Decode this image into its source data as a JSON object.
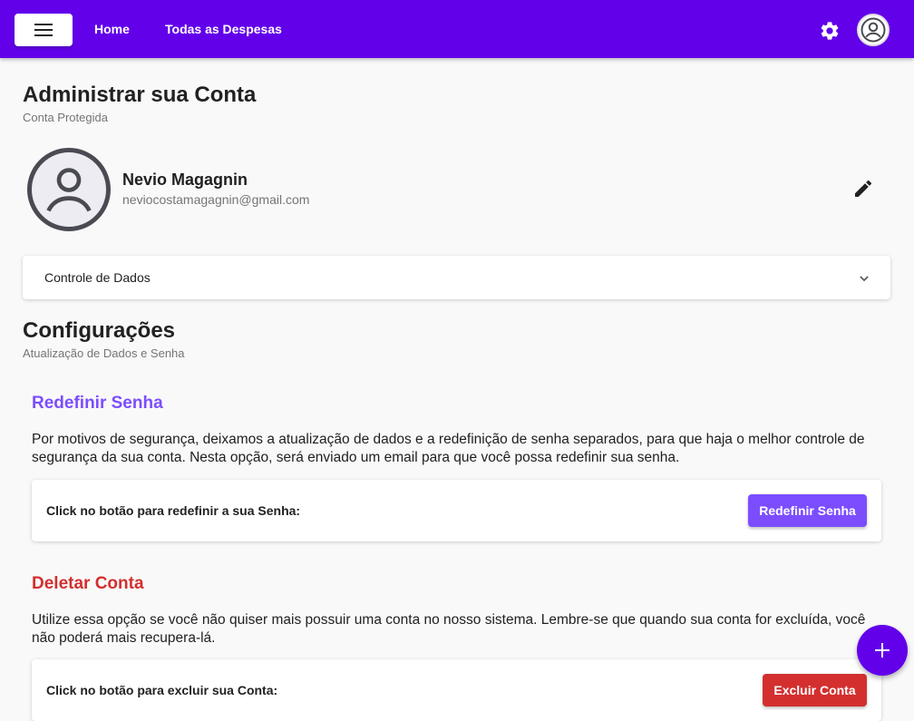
{
  "header": {
    "nav": [
      {
        "label": "Home"
      },
      {
        "label": "Todas as Despesas"
      }
    ],
    "icons": [
      "menu-icon",
      "gear-icon",
      "account-icon"
    ],
    "bar_color": "#6200ea"
  },
  "page": {
    "title": "Administrar sua Conta",
    "subtitle": "Conta Protegida"
  },
  "profile": {
    "name": "Nevio Magagnin",
    "email": "neviocostamagagnin@gmail.com"
  },
  "expansion": {
    "label": "Controle de Dados"
  },
  "settings": {
    "title": "Configurações",
    "subtitle": "Atualização de Dados e Senha"
  },
  "reset_password": {
    "heading": "Redefinir Senha",
    "heading_color": "#7c4dff",
    "description": "Por motivos de segurança, deixamos a atualização de dados e a redefinição de senha separados, para que haja o melhor controle de segurança da sua conta. Nesta opção, será enviado um email para que você possa redefinir sua senha.",
    "card_label": "Click no botão para redefinir a sua Senha:",
    "button_label": "Redefinir Senha"
  },
  "delete_account": {
    "heading": "Deletar Conta",
    "heading_color": "#d32f2f",
    "description": "Utilize essa opção se você não quiser mais possuir uma conta no nosso sistema. Lembre-se que quando sua conta for excluída, você não poderá mais recupera-lá.",
    "card_label": "Click no botão para excluir sua Conta:",
    "button_label": "Excluir Conta"
  }
}
